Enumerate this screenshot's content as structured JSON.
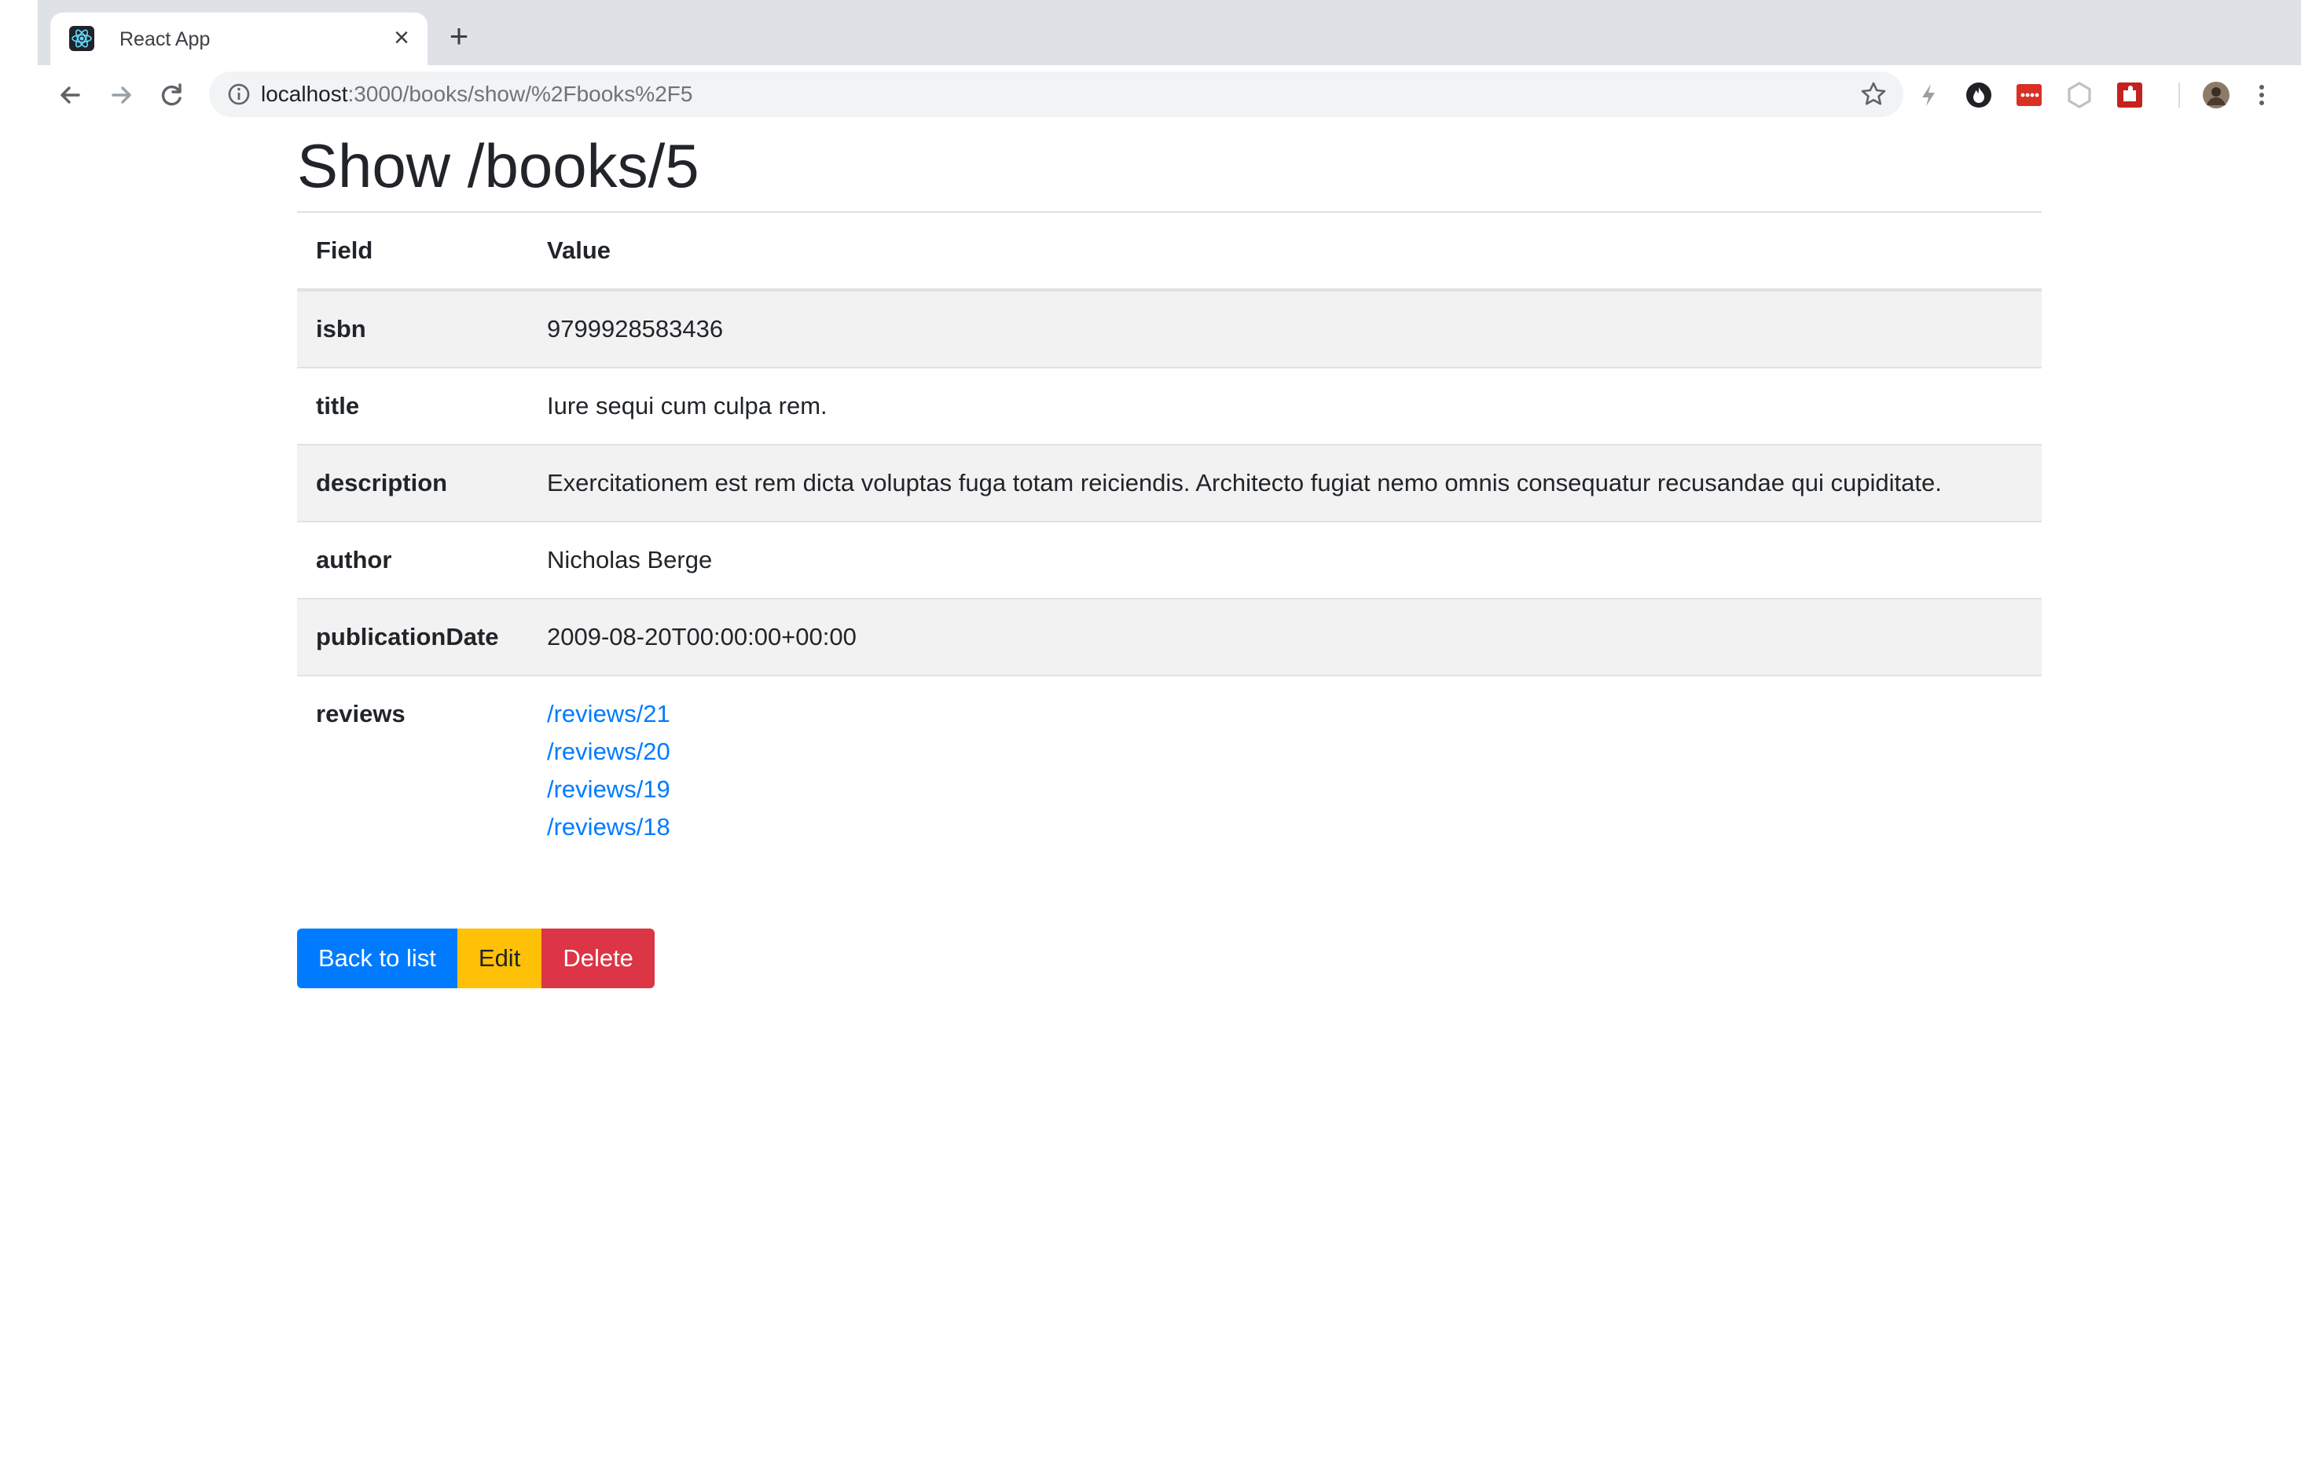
{
  "browser": {
    "tab_title": "React App",
    "url_host": "localhost",
    "url_rest": ":3000/books/show/%2Fbooks%2F5"
  },
  "page": {
    "title": "Show /books/5"
  },
  "table": {
    "headers": {
      "field": "Field",
      "value": "Value"
    },
    "rows": [
      {
        "field": "isbn",
        "value": "9799928583436"
      },
      {
        "field": "title",
        "value": "Iure sequi cum culpa rem."
      },
      {
        "field": "description",
        "value": "Exercitationem est rem dicta voluptas fuga totam reiciendis. Architecto fugiat nemo omnis consequatur recusandae qui cupiditate."
      },
      {
        "field": "author",
        "value": "Nicholas Berge"
      },
      {
        "field": "publicationDate",
        "value": "2009-08-20T00:00:00+00:00"
      }
    ],
    "reviews": {
      "field": "reviews",
      "links": [
        "/reviews/21",
        "/reviews/20",
        "/reviews/19",
        "/reviews/18"
      ]
    }
  },
  "actions": {
    "back": "Back to list",
    "edit": "Edit",
    "delete": "Delete"
  },
  "colors": {
    "primary": "#007bff",
    "warning": "#ffc107",
    "danger": "#dc3545",
    "striped_row": "#f2f2f2"
  }
}
